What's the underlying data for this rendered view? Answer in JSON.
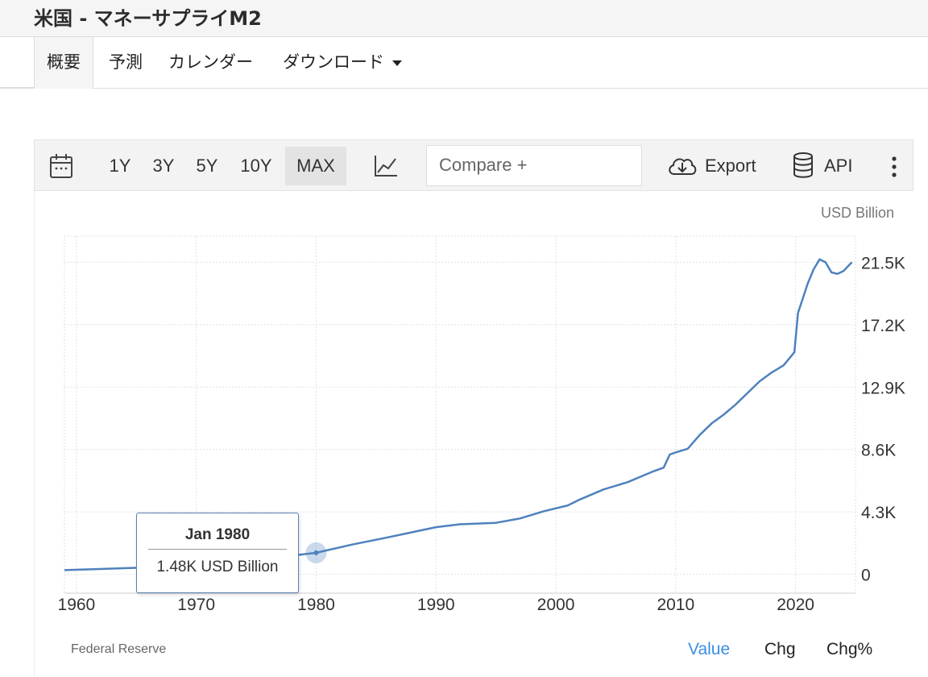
{
  "page": {
    "title": "米国 - マネーサプライM2"
  },
  "tabs": [
    {
      "label": "概要",
      "active": true
    },
    {
      "label": "予測"
    },
    {
      "label": "カレンダー"
    },
    {
      "label": "ダウンロード"
    }
  ],
  "toolbar": {
    "ranges": [
      "1Y",
      "3Y",
      "5Y",
      "10Y",
      "MAX"
    ],
    "active_range": "MAX",
    "compare_placeholder": "Compare +",
    "export_label": "Export",
    "api_label": "API",
    "icons": {
      "calendar": "calendar-icon",
      "chart_type": "line-chart-icon",
      "export": "cloud-download-icon",
      "api": "database-icon",
      "more": "vertical-ellipsis-icon"
    }
  },
  "chart_data": {
    "type": "line",
    "unit_label": "USD Billion",
    "x_ticks": [
      "1960",
      "1970",
      "1980",
      "1990",
      "2000",
      "2010",
      "2020"
    ],
    "y_ticks": [
      "0",
      "4.3K",
      "8.6K",
      "12.9K",
      "17.2K",
      "21.5K"
    ],
    "y_tick_values": [
      0,
      4300,
      8600,
      12900,
      17200,
      21500
    ],
    "xlim": [
      1959,
      2025
    ],
    "ylim": [
      -1300,
      23300
    ],
    "grid": true,
    "line_color": "#4f81bd",
    "series": [
      {
        "points": [
          [
            1959.0,
            290
          ],
          [
            1965.0,
            450
          ],
          [
            1970.0,
            620
          ],
          [
            1975.0,
            1000
          ],
          [
            1980.0,
            1480
          ],
          [
            1983.0,
            2050
          ],
          [
            1986.0,
            2550
          ],
          [
            1988.0,
            2900
          ],
          [
            1990.0,
            3250
          ],
          [
            1992.0,
            3450
          ],
          [
            1995.0,
            3550
          ],
          [
            1997.0,
            3850
          ],
          [
            1999.0,
            4350
          ],
          [
            2001.0,
            4750
          ],
          [
            2002.0,
            5150
          ],
          [
            2004.0,
            5850
          ],
          [
            2006.0,
            6350
          ],
          [
            2008.0,
            7050
          ],
          [
            2009.0,
            7350
          ],
          [
            2009.5,
            8250
          ],
          [
            2010.0,
            8400
          ],
          [
            2011.0,
            8650
          ],
          [
            2012.0,
            9600
          ],
          [
            2013.0,
            10400
          ],
          [
            2014.0,
            11000
          ],
          [
            2015.0,
            11700
          ],
          [
            2016.0,
            12500
          ],
          [
            2017.0,
            13300
          ],
          [
            2018.0,
            13900
          ],
          [
            2019.0,
            14400
          ],
          [
            2019.9,
            15300
          ],
          [
            2020.2,
            18000
          ],
          [
            2021.0,
            20000
          ],
          [
            2021.5,
            21000
          ],
          [
            2022.0,
            21700
          ],
          [
            2022.5,
            21500
          ],
          [
            2023.0,
            20800
          ],
          [
            2023.5,
            20700
          ],
          [
            2024.0,
            20900
          ],
          [
            2024.7,
            21500
          ]
        ]
      }
    ],
    "highlight": {
      "x": 1980.0,
      "y": 1480,
      "date_label": "Jan 1980",
      "value_label": "1.48K USD Billion"
    }
  },
  "footer": {
    "source": "Federal Reserve",
    "tabs": [
      "Value",
      "Chg",
      "Chg%"
    ],
    "active_tab": "Value",
    "active_color": "#3a8ee6"
  }
}
